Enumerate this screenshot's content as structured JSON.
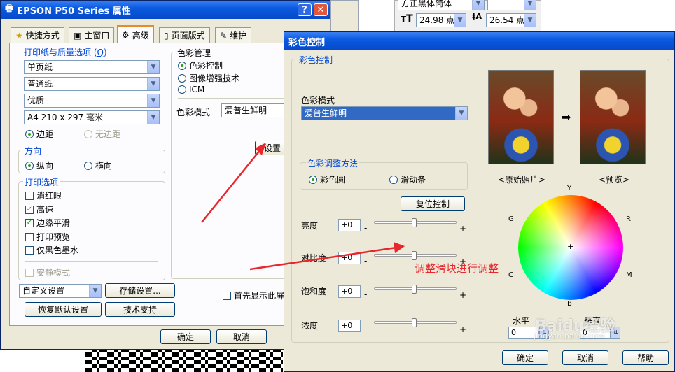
{
  "epson": {
    "title": "EPSON P50 Series 属性",
    "tabs": [
      "快捷方式",
      "主窗口",
      "高级",
      "页面版式",
      "维护"
    ],
    "paper_group": "打印纸与质量选项",
    "paper_group_key": "Q",
    "paper_type": "单页纸",
    "paper_media": "普通纸",
    "quality": "优质",
    "paper_size": "A4 210 x 297 毫米",
    "margin_with": "边距",
    "margin_none": "无边距",
    "orientation_group": "方向",
    "portrait": "纵向",
    "landscape": "横向",
    "print_options_group": "打印选项",
    "opt_redeye": "消红眼",
    "opt_highspeed": "高速",
    "opt_edge_smooth": "边缘平滑",
    "opt_preview": "打印预览",
    "opt_black_only": "仅黑色墨水",
    "opt_quiet": "安静模式",
    "color_mgmt_group": "色彩管理",
    "cm_color_control": "色彩控制",
    "cm_image_enhance": "图像增强技术",
    "cm_icm": "ICM",
    "color_mode_label": "色彩模式",
    "color_mode_value": "爱普生鲜明",
    "settings_button": "设置",
    "custom_settings": "自定义设置",
    "save_settings": "存储设置...",
    "restore_defaults": "恢复默认设置",
    "tech_support": "技术支持",
    "show_first": "首先显示此屏",
    "ok": "确定",
    "cancel": "取消"
  },
  "font_toolbar": {
    "font_name": "方正黑体简体",
    "size1": "24.98 点",
    "size2": "26.54 点"
  },
  "color_dialog": {
    "title": "彩色控制",
    "group_label": "彩色控制",
    "color_mode_label": "色彩模式",
    "color_mode_value": "爱普生鲜明",
    "method_group": "色彩调整方法",
    "method_wheel": "彩色圆",
    "method_slider": "滑动条",
    "reset_button": "复位控制",
    "sliders": [
      {
        "label": "亮度",
        "value": "+0"
      },
      {
        "label": "对比度",
        "value": "+0"
      },
      {
        "label": "饱和度",
        "value": "+0"
      },
      {
        "label": "浓度",
        "value": "+0"
      }
    ],
    "minus": "-",
    "plus": "+",
    "original_caption": "<原始照片>",
    "preview_caption": "<预览>",
    "wheel_labels": {
      "y": "Y",
      "r": "R",
      "m": "M",
      "b": "B",
      "c": "C",
      "g": "G"
    },
    "horizontal_label": "水平",
    "vertical_label": "垂直",
    "horizontal_value": "0",
    "vertical_value": "0",
    "ok": "确定",
    "cancel": "取消",
    "help": "帮助"
  },
  "annotation_text": "调整滑块进行调整",
  "watermark": {
    "brand": "Baidu经验",
    "url": "jingyan.baidu.com"
  },
  "colors": {
    "title_blue": "#0a5ae0",
    "annotation_red": "#e8262b",
    "group_label_blue": "#0046d5"
  }
}
